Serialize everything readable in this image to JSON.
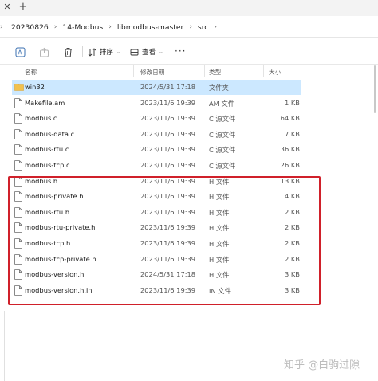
{
  "tabstrip": {
    "close_glyph": "✕",
    "new_tab_glyph": "+"
  },
  "breadcrumbs": [
    "20230826",
    "14-Modbus",
    "libmodbus-master",
    "src"
  ],
  "toolbar": {
    "sort_label": "排序",
    "view_label": "查看",
    "more_glyph": "···"
  },
  "columns": {
    "name": "名称",
    "date": "修改日期",
    "type": "类型",
    "size": "大小"
  },
  "files": [
    {
      "name": "win32",
      "date": "2024/5/31 17:18",
      "type": "文件夹",
      "size": "",
      "icon": "folder-icon",
      "selected": true
    },
    {
      "name": "Makefile.am",
      "date": "2023/11/6 19:39",
      "type": "AM 文件",
      "size": "1 KB",
      "icon": "file-icon"
    },
    {
      "name": "modbus.c",
      "date": "2023/11/6 19:39",
      "type": "C 源文件",
      "size": "64 KB",
      "icon": "file-icon"
    },
    {
      "name": "modbus-data.c",
      "date": "2023/11/6 19:39",
      "type": "C 源文件",
      "size": "7 KB",
      "icon": "file-icon"
    },
    {
      "name": "modbus-rtu.c",
      "date": "2023/11/6 19:39",
      "type": "C 源文件",
      "size": "36 KB",
      "icon": "file-icon"
    },
    {
      "name": "modbus-tcp.c",
      "date": "2023/11/6 19:39",
      "type": "C 源文件",
      "size": "26 KB",
      "icon": "file-icon"
    },
    {
      "name": "modbus.h",
      "date": "2023/11/6 19:39",
      "type": "H 文件",
      "size": "13 KB",
      "icon": "file-icon"
    },
    {
      "name": "modbus-private.h",
      "date": "2023/11/6 19:39",
      "type": "H 文件",
      "size": "4 KB",
      "icon": "file-icon"
    },
    {
      "name": "modbus-rtu.h",
      "date": "2023/11/6 19:39",
      "type": "H 文件",
      "size": "2 KB",
      "icon": "file-icon"
    },
    {
      "name": "modbus-rtu-private.h",
      "date": "2023/11/6 19:39",
      "type": "H 文件",
      "size": "2 KB",
      "icon": "file-icon"
    },
    {
      "name": "modbus-tcp.h",
      "date": "2023/11/6 19:39",
      "type": "H 文件",
      "size": "2 KB",
      "icon": "file-icon"
    },
    {
      "name": "modbus-tcp-private.h",
      "date": "2023/11/6 19:39",
      "type": "H 文件",
      "size": "2 KB",
      "icon": "file-icon"
    },
    {
      "name": "modbus-version.h",
      "date": "2024/5/31 17:18",
      "type": "H 文件",
      "size": "3 KB",
      "icon": "file-icon"
    },
    {
      "name": "modbus-version.h.in",
      "date": "2023/11/6 19:39",
      "type": "IN 文件",
      "size": "3 KB",
      "icon": "file-icon"
    }
  ],
  "watermark": "知乎 @白驹过隙",
  "colors": {
    "selection": "#cce8ff",
    "highlight_box": "#d0202a",
    "folder": "#f2c14e"
  }
}
